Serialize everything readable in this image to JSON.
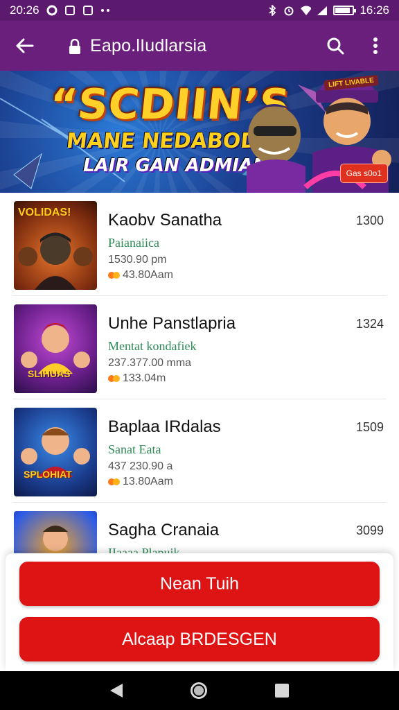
{
  "status_bar": {
    "time_left": "20:26",
    "time_right": "16:26",
    "left_icons": [
      "notification-icon",
      "image-icon",
      "image-icon",
      "more-icon"
    ],
    "right_icons": [
      "bluetooth-icon",
      "alarm-icon",
      "wifi-icon",
      "signal-icon",
      "battery-icon"
    ],
    "battery_level": 0.85
  },
  "app_bar": {
    "title": "Eapo.lIudlarsia",
    "back_icon": "arrow-left-icon",
    "lock_icon": "lock-icon",
    "search_icon": "search-icon",
    "menu_icon": "more-vertical-icon"
  },
  "banner": {
    "headline": "“SCDIIN’S",
    "line2": "MANE NEDABODEZ",
    "line3": "LAIR GAN ADMIAN",
    "badge": "Gas s0o1",
    "corner_tag": "LIFT LIVABLE",
    "colors": {
      "headline": "#ffcf2a",
      "badge": "#e0301e"
    }
  },
  "list": {
    "items": [
      {
        "name": "Kaobv Sanatha",
        "subtitle": "Paianaiica",
        "time": "1530.90 pm",
        "distance": "43.80Aam",
        "number": "1300",
        "thumb_text": "VOLIDAS!",
        "thumb_theme": "warm"
      },
      {
        "name": "Unhe Panstlapria",
        "subtitle": "Mentat kondafiek",
        "time": "237.377.00 mma",
        "distance": "133.04m",
        "number": "1324",
        "thumb_text": "SLIHUAS",
        "thumb_theme": "purple"
      },
      {
        "name": "Baplaa IRdalas",
        "subtitle": "Sanat Eata",
        "time": "437 230.90 a",
        "distance": "13.80Aam",
        "number": "1509",
        "thumb_text": "SPLOHIAT",
        "thumb_theme": "blue"
      },
      {
        "name": "Sagha Cranaia",
        "subtitle": "IIaaaa Plapuik",
        "time": "",
        "distance": "",
        "number": "3099",
        "thumb_text": "",
        "thumb_theme": "gold"
      }
    ]
  },
  "actions": {
    "primary_label": "Nean Tuih",
    "secondary_label": "Alcaap BRDESGEN",
    "color": "#de1414"
  },
  "nav": {
    "back_icon": "back-triangle-icon",
    "home_icon": "home-circle-icon",
    "recents_icon": "recents-square-icon"
  }
}
